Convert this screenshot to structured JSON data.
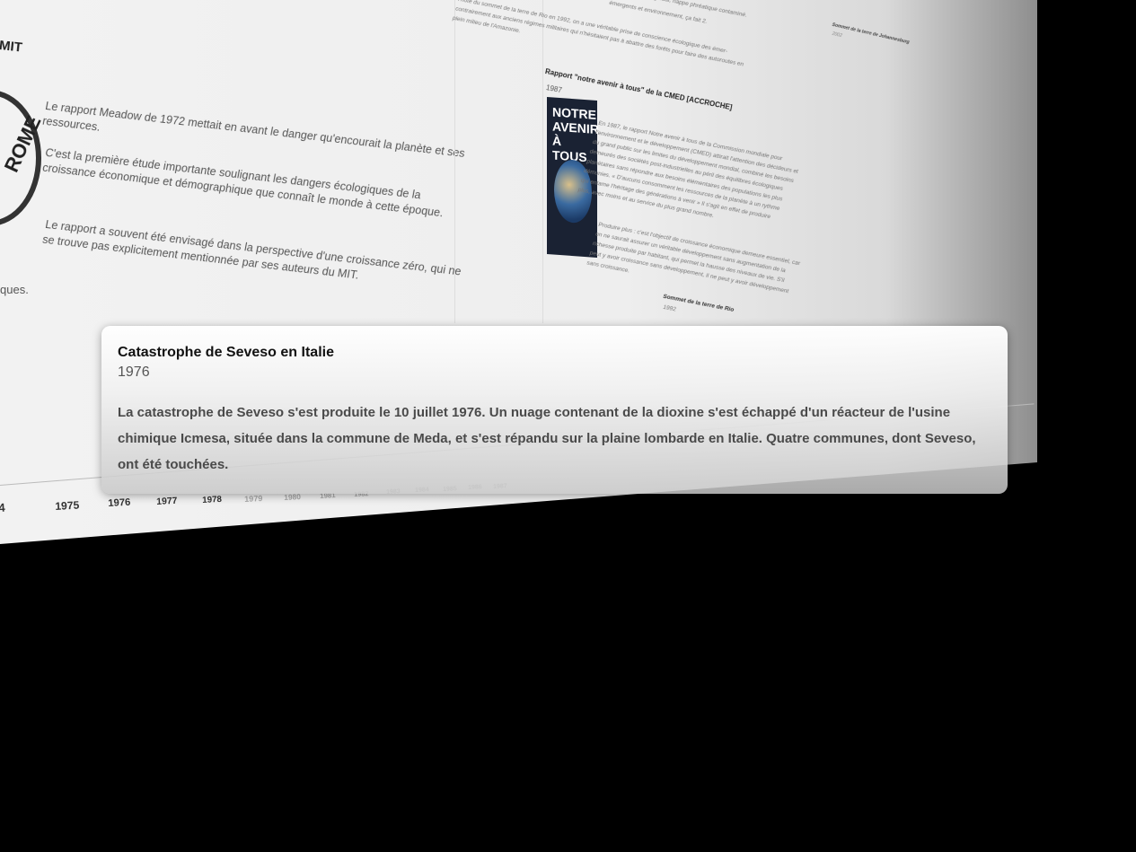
{
  "background": {
    "mit_label": "MIT",
    "logo_text": "ROME",
    "paragraphs": [
      "Le rapport Meadow de 1972 mettait en avant le danger qu'encourait la planète et ses ressources.",
      "C'est la première étude importante soulignant les dangers écologiques de la croissance économique et démographique que connaît le monde à cette époque.",
      "Le rapport a souvent été envisagé dans la perspective d'une croissance zéro, qui ne se trouve pas explicitement mentionnée par ses auteurs du MIT."
    ],
    "ques_fragment": "ques.",
    "rapport_title": "Rapport \"notre avenir à tous\" de la CMED [ACCROCHE]",
    "rapport_year": "1987",
    "book_cover_text": "NOTRE AVENIR À TOUS",
    "rapport_text": "En 1987, le rapport Notre avenir à tous de la Commission mondiale pour l'environnement et le développement (CMED) attirait l'attention des décideurs et du grand public sur les limites du développement mondial, combiné les besoins demeurés des sociétés post-industrielles au péril des équilibres écologiques planétaires sans répondre aux besoins élémentaires des populations les plus démunies. « D'aucuns consomment les ressources de la planète à un rythme qui entame l'héritage des générations à venir » Il s'agit en effet de produire plus, avec moins et au service du plus grand nombre.",
    "rapport_text_2": "Produire plus : c'est l'objectif de croissance économique demeure essentiel, car on ne saurait assurer un véritable développement sans augmentation de la richesse produite par habitant, qui permet la hausse des niveaux de vie. S'il peut y avoir croissance sans développement, il ne peut y avoir développement sans croissance.",
    "rio_top_text": "l'hôte du sommet de la terre de Rio en 1992, on a une véritable prise de conscience écologique des émer- contrairement aux anciens régimes militaires qui n'hésitaient pas à abattre des forêts pour faire des autoroutes en plein milieu de l'Amazonie.",
    "rio_top_fragment": "émergents et environnement, ça fait 2.",
    "rio_top_fragment_2": "global, nappe phréatique contaminé.",
    "sommet_rio_title": "Sommet de la terre de Rio",
    "sommet_rio_year": "1992",
    "johannesburg_title": "Sommet de la terre de Johannesburg",
    "johannesburg_year": "2002"
  },
  "timeline": {
    "years": [
      "4",
      "1975",
      "1976",
      "1977",
      "1978",
      "1979",
      "1980",
      "1981",
      "1982",
      "1983",
      "1984",
      "1985",
      "1986",
      "1987"
    ]
  },
  "card": {
    "title": "Catastrophe de Seveso en Italie",
    "year": "1976",
    "body": "La catastrophe de Seveso s'est produite le 10 juillet 1976. Un nuage contenant de la dioxine s'est échappé d'un réacteur de l'usine chimique Icmesa, située dans la commune de Meda, et s'est répandu sur la plaine lombarde en Italie. Quatre communes, dont Seveso, ont été touchées."
  }
}
